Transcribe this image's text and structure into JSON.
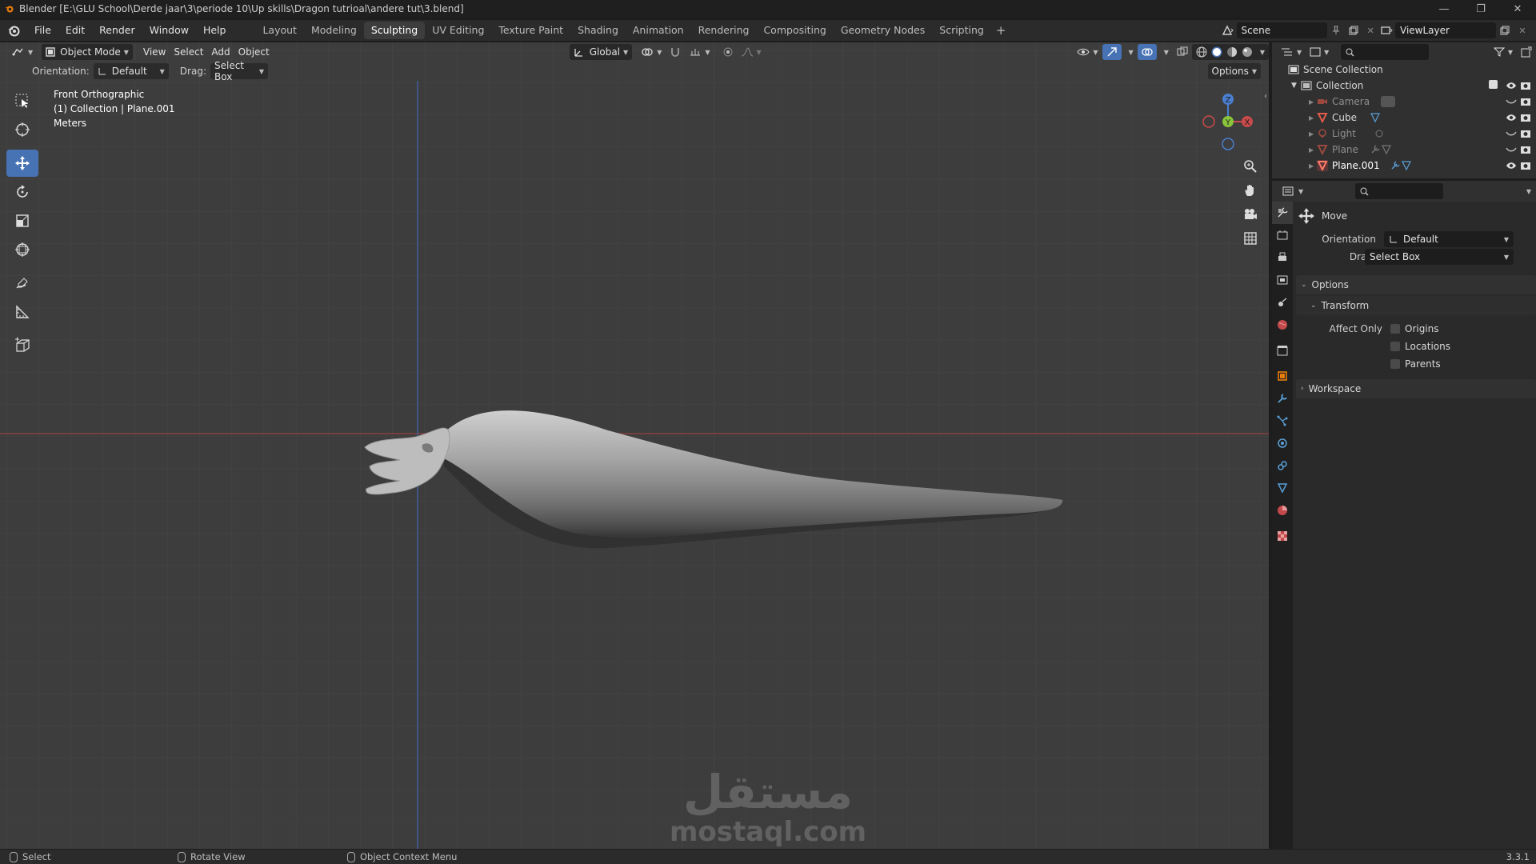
{
  "window": {
    "title": "Blender [E:\\GLU School\\Derde jaar\\3\\periode 10\\Up skills\\Dragon tutrioal\\andere tut\\3.blend]",
    "minimize": "—",
    "maximize": "❐",
    "close": "✕"
  },
  "menubar": {
    "menus": [
      "File",
      "Edit",
      "Render",
      "Window",
      "Help"
    ],
    "workspaces": [
      "Layout",
      "Modeling",
      "Sculpting",
      "UV Editing",
      "Texture Paint",
      "Shading",
      "Animation",
      "Rendering",
      "Compositing",
      "Geometry Nodes",
      "Scripting"
    ],
    "active_workspace": "Sculpting",
    "add_tab": "+",
    "scene": "Scene",
    "view_layer": "ViewLayer"
  },
  "viewport": {
    "mode": "Object Mode",
    "menus": [
      "View",
      "Select",
      "Add",
      "Object"
    ],
    "transform_orientation": "Global",
    "orientation_label": "Orientation:",
    "orientation_value": "Default",
    "drag_label": "Drag:",
    "drag_value": "Select Box",
    "options_label": "Options",
    "info": {
      "view": "Front Orthographic",
      "collection": "(1) Collection | Plane.001",
      "units": "Meters"
    },
    "gizmo": {
      "z": "Z",
      "y": "Y",
      "x": "X"
    }
  },
  "watermark": {
    "arabic": "مستقل",
    "latin": "mostaql.com"
  },
  "outliner": {
    "root": "Scene Collection",
    "collection": "Collection",
    "items": [
      {
        "name": "Camera",
        "dim": true
      },
      {
        "name": "Cube",
        "dim": false
      },
      {
        "name": "Light",
        "dim": true
      },
      {
        "name": "Plane",
        "dim": true
      },
      {
        "name": "Plane.001",
        "dim": false
      }
    ]
  },
  "properties": {
    "tool_name": "Move",
    "orientation_label": "Orientation",
    "orientation_value": "Default",
    "drag_label": "Drag:",
    "drag_value": "Select Box",
    "options_section": "Options",
    "transform_section": "Transform",
    "affect_only_label": "Affect Only",
    "affect_only": [
      "Origins",
      "Locations",
      "Parents"
    ],
    "workspace_section": "Workspace"
  },
  "statusbar": {
    "select": "Select",
    "rotate": "Rotate View",
    "context": "Object Context Menu",
    "version": "3.3.1"
  },
  "colors": {
    "accent": "#4772b3",
    "x_axis": "#c84a4a",
    "y_axis": "#8ac43a",
    "z_axis": "#4a7fd0",
    "mesh_red": "#e25a4a"
  }
}
